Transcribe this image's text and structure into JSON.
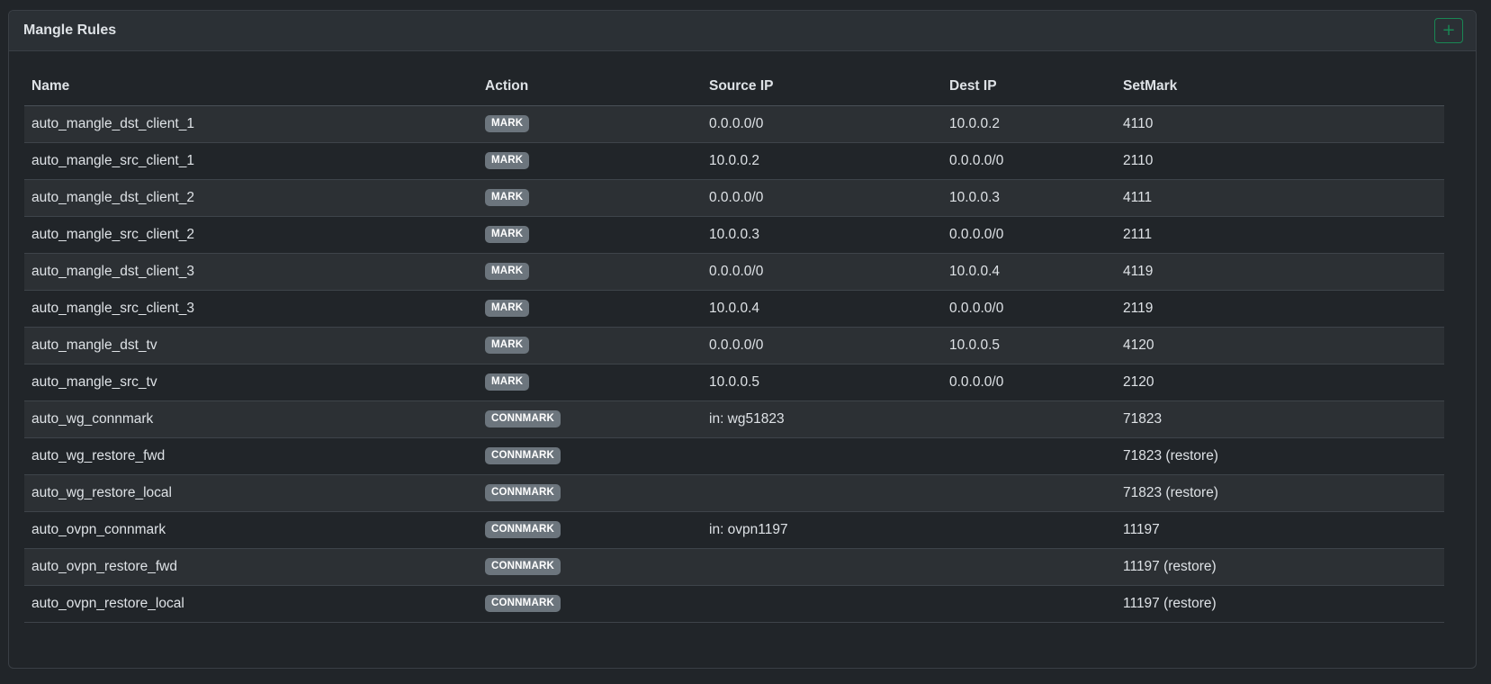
{
  "card": {
    "title": "Mangle Rules",
    "add_button_label": "+"
  },
  "table": {
    "columns": [
      "Name",
      "Action",
      "Source IP",
      "Dest IP",
      "SetMark"
    ],
    "rows": [
      {
        "name": "auto_mangle_dst_client_1",
        "action": "MARK",
        "source_ip": "0.0.0.0/0",
        "dest_ip": "10.0.0.2",
        "setmark": "4110"
      },
      {
        "name": "auto_mangle_src_client_1",
        "action": "MARK",
        "source_ip": "10.0.0.2",
        "dest_ip": "0.0.0.0/0",
        "setmark": "2110"
      },
      {
        "name": "auto_mangle_dst_client_2",
        "action": "MARK",
        "source_ip": "0.0.0.0/0",
        "dest_ip": "10.0.0.3",
        "setmark": "4111"
      },
      {
        "name": "auto_mangle_src_client_2",
        "action": "MARK",
        "source_ip": "10.0.0.3",
        "dest_ip": "0.0.0.0/0",
        "setmark": "2111"
      },
      {
        "name": "auto_mangle_dst_client_3",
        "action": "MARK",
        "source_ip": "0.0.0.0/0",
        "dest_ip": "10.0.0.4",
        "setmark": "4119"
      },
      {
        "name": "auto_mangle_src_client_3",
        "action": "MARK",
        "source_ip": "10.0.0.4",
        "dest_ip": "0.0.0.0/0",
        "setmark": "2119"
      },
      {
        "name": "auto_mangle_dst_tv",
        "action": "MARK",
        "source_ip": "0.0.0.0/0",
        "dest_ip": "10.0.0.5",
        "setmark": "4120"
      },
      {
        "name": "auto_mangle_src_tv",
        "action": "MARK",
        "source_ip": "10.0.0.5",
        "dest_ip": "0.0.0.0/0",
        "setmark": "2120"
      },
      {
        "name": "auto_wg_connmark",
        "action": "CONNMARK",
        "source_ip": "in: wg51823",
        "dest_ip": "",
        "setmark": "71823"
      },
      {
        "name": "auto_wg_restore_fwd",
        "action": "CONNMARK",
        "source_ip": "",
        "dest_ip": "",
        "setmark": "71823 (restore)"
      },
      {
        "name": "auto_wg_restore_local",
        "action": "CONNMARK",
        "source_ip": "",
        "dest_ip": "",
        "setmark": "71823 (restore)"
      },
      {
        "name": "auto_ovpn_connmark",
        "action": "CONNMARK",
        "source_ip": "in: ovpn1197",
        "dest_ip": "",
        "setmark": "11197"
      },
      {
        "name": "auto_ovpn_restore_fwd",
        "action": "CONNMARK",
        "source_ip": "",
        "dest_ip": "",
        "setmark": "11197 (restore)"
      },
      {
        "name": "auto_ovpn_restore_local",
        "action": "CONNMARK",
        "source_ip": "",
        "dest_ip": "",
        "setmark": "11197 (restore)"
      }
    ]
  },
  "colors": {
    "page_background": "#212529",
    "header_background": "#2b3035",
    "striped_row": "#2c3034",
    "badge_background": "#6c757d",
    "add_button_accent": "#198754"
  }
}
